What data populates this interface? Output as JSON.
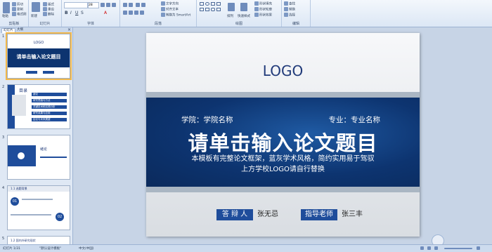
{
  "ribbon": {
    "groups": [
      {
        "label": "剪贴板"
      },
      {
        "label": "幻灯片"
      },
      {
        "label": "字体"
      },
      {
        "label": "段落"
      },
      {
        "label": "绘图"
      },
      {
        "label": "编辑"
      }
    ],
    "clipboard": {
      "paste": "粘贴",
      "cut": "剪切",
      "copy": "复制",
      "format": "格式刷"
    },
    "slides": {
      "new": "新建",
      "layout": "版式",
      "reset": "重设",
      "delete": "删除"
    },
    "font": {
      "size": "28"
    },
    "paragraph": {
      "text_direction": "文字方向",
      "align_text": "对齐文本",
      "smartart": "转换为 SmartArt"
    },
    "drawing": {
      "arrange": "排列",
      "quick_styles": "快速样式",
      "fill": "形状填充",
      "outline": "形状轮廓",
      "effects": "形状效果"
    },
    "editing": {
      "find": "查找",
      "replace": "替换",
      "select": "选择"
    }
  },
  "pane": {
    "tab_slides": "幻灯片",
    "tab_outline": "大纲",
    "close": "×",
    "thumbs": [
      {
        "num": "1",
        "logo": "LOGO",
        "title": "请单击输入论文题目"
      },
      {
        "num": "2",
        "heading": "目录",
        "items": [
          "绪论",
          "研究思路与方法",
          "关键技术和实践分析",
          "研究成果与应用",
          "结论与未来展望"
        ]
      },
      {
        "num": "3",
        "heading": "绪论",
        "sub": "01"
      },
      {
        "num": "4",
        "heading": "1.1 选题背景",
        "left_num": "01",
        "right_num": "02"
      },
      {
        "num": "5",
        "heading": "1.2 国内外研究现状"
      }
    ]
  },
  "slide": {
    "logo": "LOGO",
    "school": "学院：学院名称",
    "major": "专业：专业名称",
    "title": "请单击输入论文题目",
    "desc_line1": "本模板有完整论文框架，蓝灰学术风格，简约实用易于驾驭",
    "desc_line2": "上方学校LOGO请自行替换",
    "defender_label": "答 辩 人",
    "defender_name": "张无忌",
    "advisor_label": "指导老师",
    "advisor_name": "张三丰"
  },
  "status": {
    "slide_info": "幻灯片 1/31",
    "theme": "\"默认设计模板\"",
    "language": "中文(中国)"
  },
  "colors": {
    "accent": "#1f4d9b",
    "band": "#0d3470"
  }
}
